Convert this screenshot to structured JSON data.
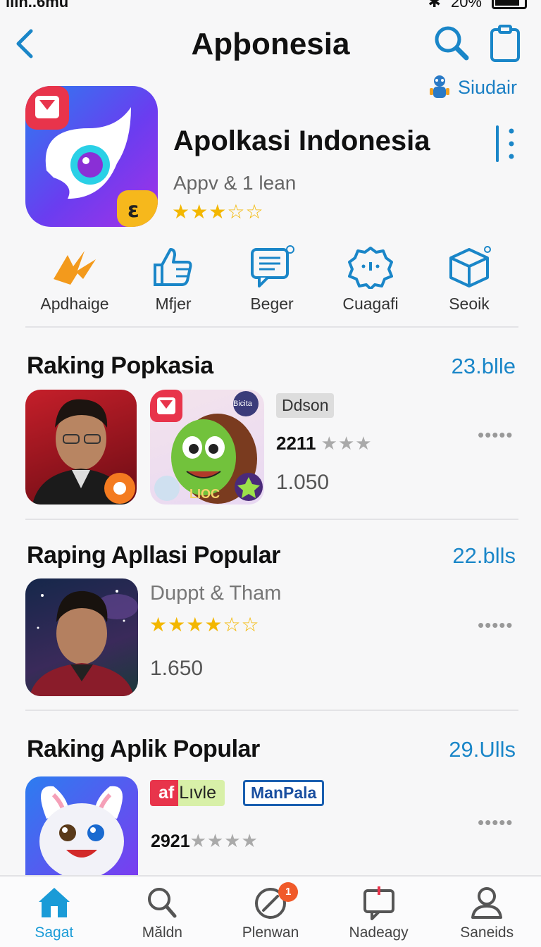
{
  "status_bar": {
    "left": "lıın..6mu",
    "battery": "20%"
  },
  "header": {
    "title": "Apþonesia"
  },
  "studio_link": {
    "label": "Siudair"
  },
  "app": {
    "title": "Apolkasi Indonesia",
    "subtitle": "Appv & 1 lean",
    "stars": "★★★☆☆",
    "rating": 3
  },
  "actions": [
    {
      "label": "Apdhaige",
      "icon": "lightning-icon"
    },
    {
      "label": "Mfjer",
      "icon": "thumbs-up-icon"
    },
    {
      "label": "Beger",
      "icon": "chat-bubble-icon"
    },
    {
      "label": "Cuagafi",
      "icon": "badge-icon"
    },
    {
      "label": "Seoik",
      "icon": "box-icon"
    }
  ],
  "sections": [
    {
      "title": "Raking Popkasia",
      "count": "23.blle",
      "tag": "Ddson",
      "rating_num": "2211",
      "stars": "★★★",
      "downloads": "1.050",
      "dots": "•••••",
      "thumb2_label": "LIOC",
      "thumb2_badge": "Bicita"
    },
    {
      "title": "Raping Apllasi Popular",
      "count": "22.blls",
      "subtitle": "Duppt & Tham",
      "stars": "★★★★☆☆",
      "downloads": "1.650",
      "dots": "•••••"
    },
    {
      "title": "Raking Aplik Popular",
      "count": "29.Ulls",
      "tag1_prefix": "af",
      "tag1": "Lıvle",
      "tag2": "ManPala",
      "rating_num": "2921",
      "stars": "★★★★",
      "dots": "•••••"
    }
  ],
  "tabs": [
    {
      "label": "Sagat",
      "icon": "home-icon",
      "active": true
    },
    {
      "label": "Măldn",
      "icon": "search-icon"
    },
    {
      "label": "Plenwan",
      "icon": "compass-icon",
      "badge": "1"
    },
    {
      "label": "Nadeagy",
      "icon": "message-icon"
    },
    {
      "label": "Saneids",
      "icon": "profile-icon"
    }
  ],
  "colors": {
    "accent": "#1a86c8",
    "star": "#f3b700",
    "active_tab": "#1a9bd7",
    "badge": "#f05a2a"
  }
}
